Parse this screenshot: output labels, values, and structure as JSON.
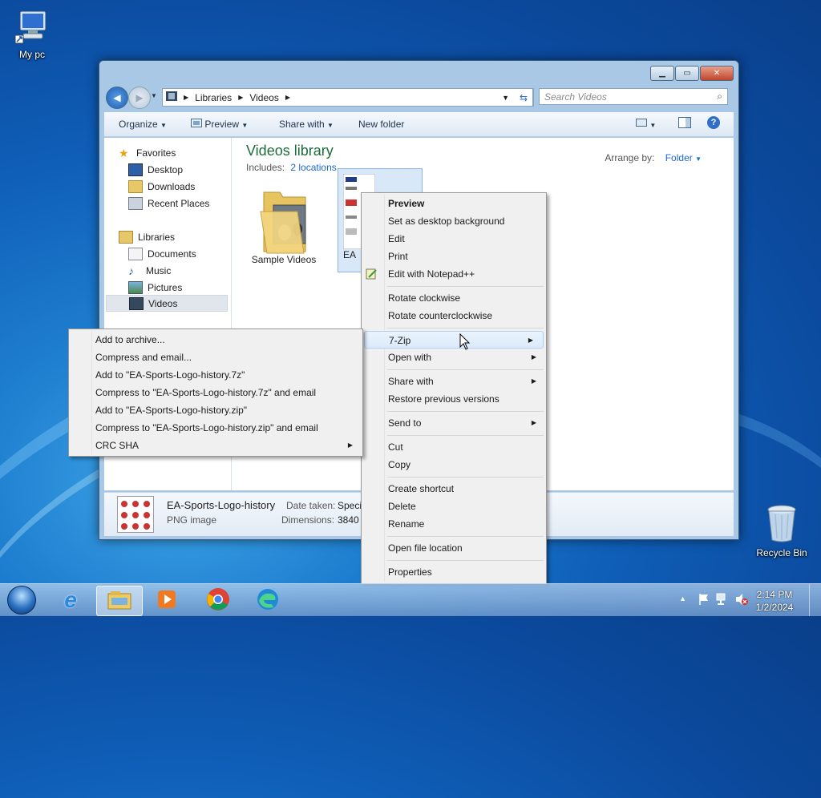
{
  "desktop": {
    "icons": [
      {
        "label": "My pc"
      },
      {
        "label": "Recycle Bin"
      }
    ]
  },
  "window": {
    "address": {
      "segments": [
        "Libraries",
        "Videos"
      ]
    },
    "search": {
      "placeholder": "Search Videos"
    },
    "toolbar": {
      "organize": "Organize",
      "preview": "Preview",
      "share_with": "Share with",
      "new_folder": "New folder"
    },
    "nav": {
      "favorites": "Favorites",
      "favorites_items": [
        "Desktop",
        "Downloads",
        "Recent Places"
      ],
      "libraries": "Libraries",
      "libraries_items": [
        "Documents",
        "Music",
        "Pictures",
        "Videos"
      ]
    },
    "library": {
      "title": "Videos library",
      "includes_label": "Includes:",
      "includes_link": "2 locations",
      "arrange_label": "Arrange by:",
      "arrange_value": "Folder"
    },
    "items": [
      {
        "label": "Sample Videos"
      },
      {
        "label": "EA"
      }
    ],
    "details": {
      "name": "EA-Sports-Logo-history",
      "type": "PNG image",
      "date_label": "Date taken:",
      "date_value": "Speci",
      "dims_label": "Dimensions:",
      "dims_value": "3840 :"
    }
  },
  "context_menu": {
    "groups": [
      [
        "Preview",
        "Set as desktop background",
        "Edit",
        "Print",
        "Edit with Notepad++"
      ],
      [
        "Rotate clockwise",
        "Rotate counterclockwise"
      ],
      [
        "7-Zip",
        "Open with"
      ],
      [
        "Share with",
        "Restore previous versions"
      ],
      [
        "Send to"
      ],
      [
        "Cut",
        "Copy"
      ],
      [
        "Create shortcut",
        "Delete",
        "Rename"
      ],
      [
        "Open file location"
      ],
      [
        "Properties"
      ]
    ]
  },
  "submenu_7zip": {
    "items": [
      "Add to archive...",
      "Compress and email...",
      "Add to \"EA-Sports-Logo-history.7z\"",
      "Compress to \"EA-Sports-Logo-history.7z\" and email",
      "Add to \"EA-Sports-Logo-history.zip\"",
      "Compress to \"EA-Sports-Logo-history.zip\" and email",
      "CRC SHA"
    ]
  },
  "taskbar": {
    "time": "2:14 PM",
    "date": "1/2/2024"
  },
  "colors": {
    "accent_link": "#1a6ad0",
    "library_title": "#1e6b3a",
    "menu_bg": "#f0f0f0"
  }
}
